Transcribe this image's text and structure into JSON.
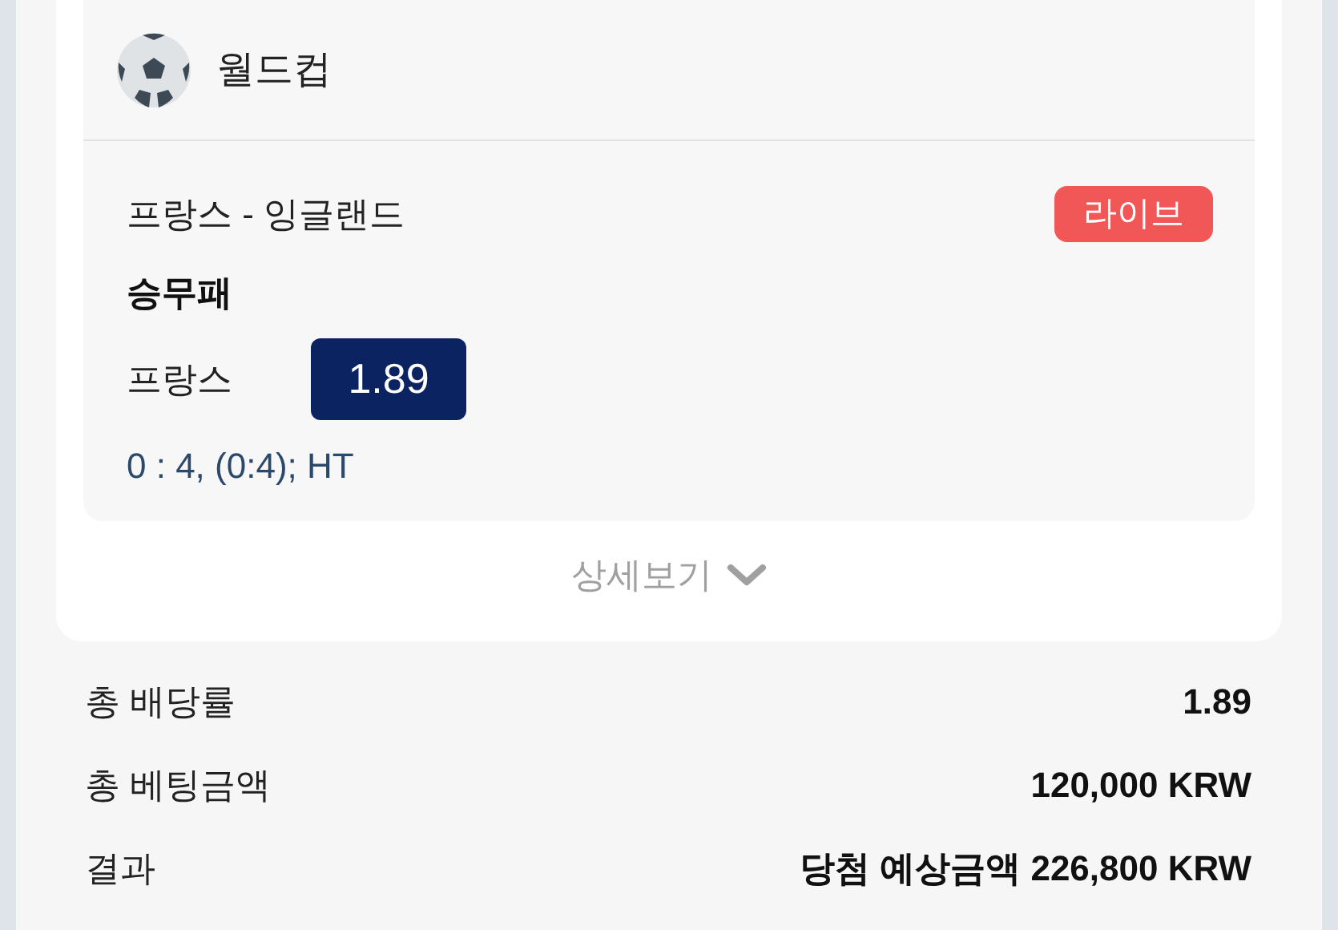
{
  "league": {
    "title": "월드컵"
  },
  "bet": {
    "match": "프랑스 - 잉글랜드",
    "status": {
      "label": "라이브",
      "kind": "live"
    },
    "market": "승무패",
    "pick": "프랑스",
    "odds": "1.89",
    "score": "0 : 4, (0:4); HT"
  },
  "details_link": {
    "label": "상세보기"
  },
  "summary": [
    {
      "label": "총 배당률",
      "value": "1.89"
    },
    {
      "label": "총 베팅금액",
      "value": "120,000 KRW"
    },
    {
      "label": "결과",
      "value": "당첨 예상금액 226,800 KRW"
    }
  ]
}
